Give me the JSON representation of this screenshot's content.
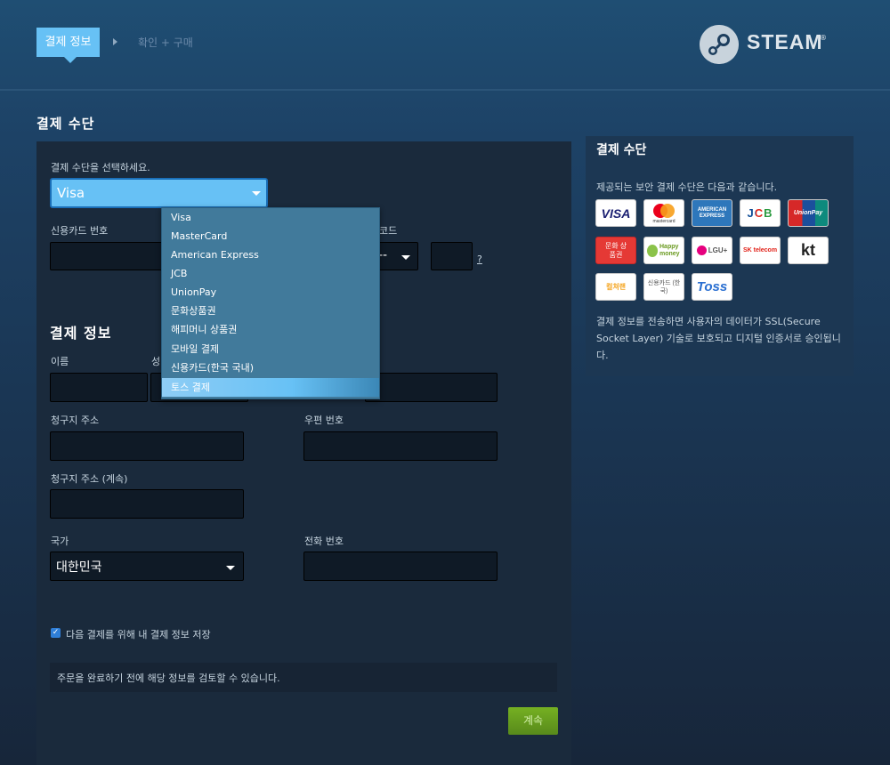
{
  "header": {
    "step_active": "결제 정보",
    "step_next": "확인 + 구매",
    "logo_text": "STEAM",
    "logo_reg": "®"
  },
  "main": {
    "section_title": "결제 수단",
    "payment_select_label": "결제 수단을 선택하세요.",
    "payment_select_value": "Visa",
    "card_number_label": "신용카드 번호",
    "security_code_label_partial": "코드",
    "expiry_partial": "--",
    "security_code_help": "?",
    "billing_heading": "결제 정보",
    "first_name_label": "이름",
    "last_name_label_partial": "성",
    "address_label": "청구지 주소",
    "zip_label": "우편 번호",
    "address2_label": "청구지 주소 (계속)",
    "country_label": "국가",
    "country_value": "대한민국",
    "phone_label": "전화 번호",
    "save_info_label": "다음 결제를 위해 내 결제 정보 저장",
    "save_info_checked": true,
    "review_note": "주문을 완료하기 전에 해당 정보를 검토할 수 있습니다.",
    "continue_button": "계속"
  },
  "dropdown": {
    "options": [
      "Visa",
      "MasterCard",
      "American Express",
      "JCB",
      "UnionPay",
      "문화상품권",
      "해피머니 상품권",
      "모바일 결제",
      "신용카드(한국 국내)",
      "토스 결제"
    ],
    "highlighted": "토스 결제"
  },
  "sidebar": {
    "title": "결제 수단",
    "intro": "제공되는 보안 결제 수단은 다음과 같습니다.",
    "cards": {
      "visa": "VISA",
      "mastercard": "mastercard",
      "amex": "AMERICAN EXPRESS",
      "jcb": "JCB",
      "unionpay": "UnionPay",
      "culture": "문화 상품권",
      "happymoney": "Happy money",
      "lgu": "LGU+",
      "sk": "SK telecom",
      "kt": "kt",
      "egift": "컬쳐랜",
      "kr_credit": "신용카드 (한국)",
      "toss": "Toss"
    },
    "note": "결제 정보를 전송하면 사용자의 데이터가 SSL(Secure Socket Layer) 기술로 보호되고 디지털 인증서로 승인됩니다."
  },
  "colors": {
    "accent": "#67c1f5",
    "continue_green": "#6aa022",
    "panel": "#1a2a3c"
  }
}
